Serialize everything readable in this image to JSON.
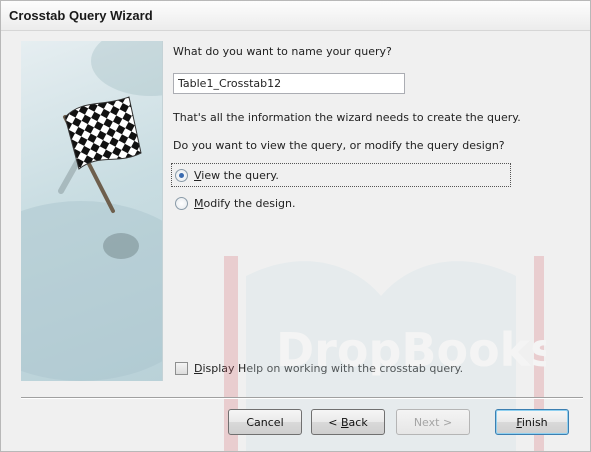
{
  "window": {
    "title": "Crosstab Query Wizard"
  },
  "prompt_name": "What do you want to name your query?",
  "query_name_value": "Table1_Crosstab12",
  "info_text": "That's all the information the wizard needs to create the query.",
  "view_or_modify_text": "Do you want to view the query, or modify the query design?",
  "options": {
    "view": {
      "accel": "V",
      "rest": "iew the query.",
      "checked": true
    },
    "modify": {
      "accel": "M",
      "rest": "odify the design.",
      "checked": false
    }
  },
  "help_checkbox": {
    "accel": "D",
    "rest": "isplay Help on working with the crosstab query.",
    "checked": false
  },
  "buttons": {
    "cancel": "Cancel",
    "back_prefix": "< ",
    "back_accel": "B",
    "back_rest": "ack",
    "next": "Next >",
    "finish_accel": "F",
    "finish_rest": "inish"
  },
  "watermark_text": "DropBooks",
  "colors": {
    "accent": "#3a6bb0",
    "panel": "#c9dde2",
    "watermark": "#d9747e"
  }
}
